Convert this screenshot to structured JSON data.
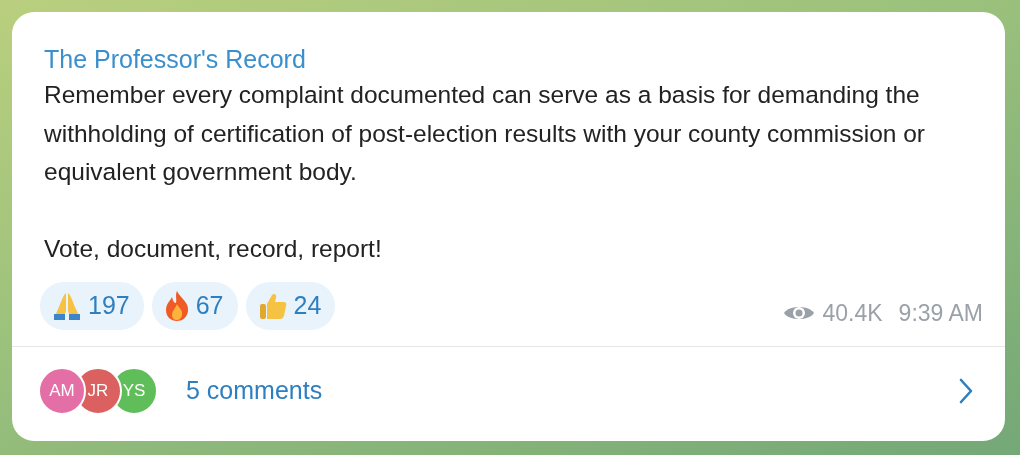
{
  "post": {
    "channel": "The Professor's Record",
    "paragraphs": [
      "Remember every complaint documented can serve as a basis for demanding the withholding of certification of post-election results with your county commission or equivalent government body.",
      "Vote, document, record, report!"
    ],
    "reactions": [
      {
        "count": "197"
      },
      {
        "count": "67"
      },
      {
        "count": "24"
      }
    ],
    "views": "40.4K",
    "time": "9:39 AM"
  },
  "comments": {
    "avatars": [
      {
        "initials": "AM",
        "color": "#e36fa6"
      },
      {
        "initials": "JR",
        "color": "#db6060"
      },
      {
        "initials": "YS",
        "color": "#5fbd5a"
      }
    ],
    "label": "5 comments"
  }
}
